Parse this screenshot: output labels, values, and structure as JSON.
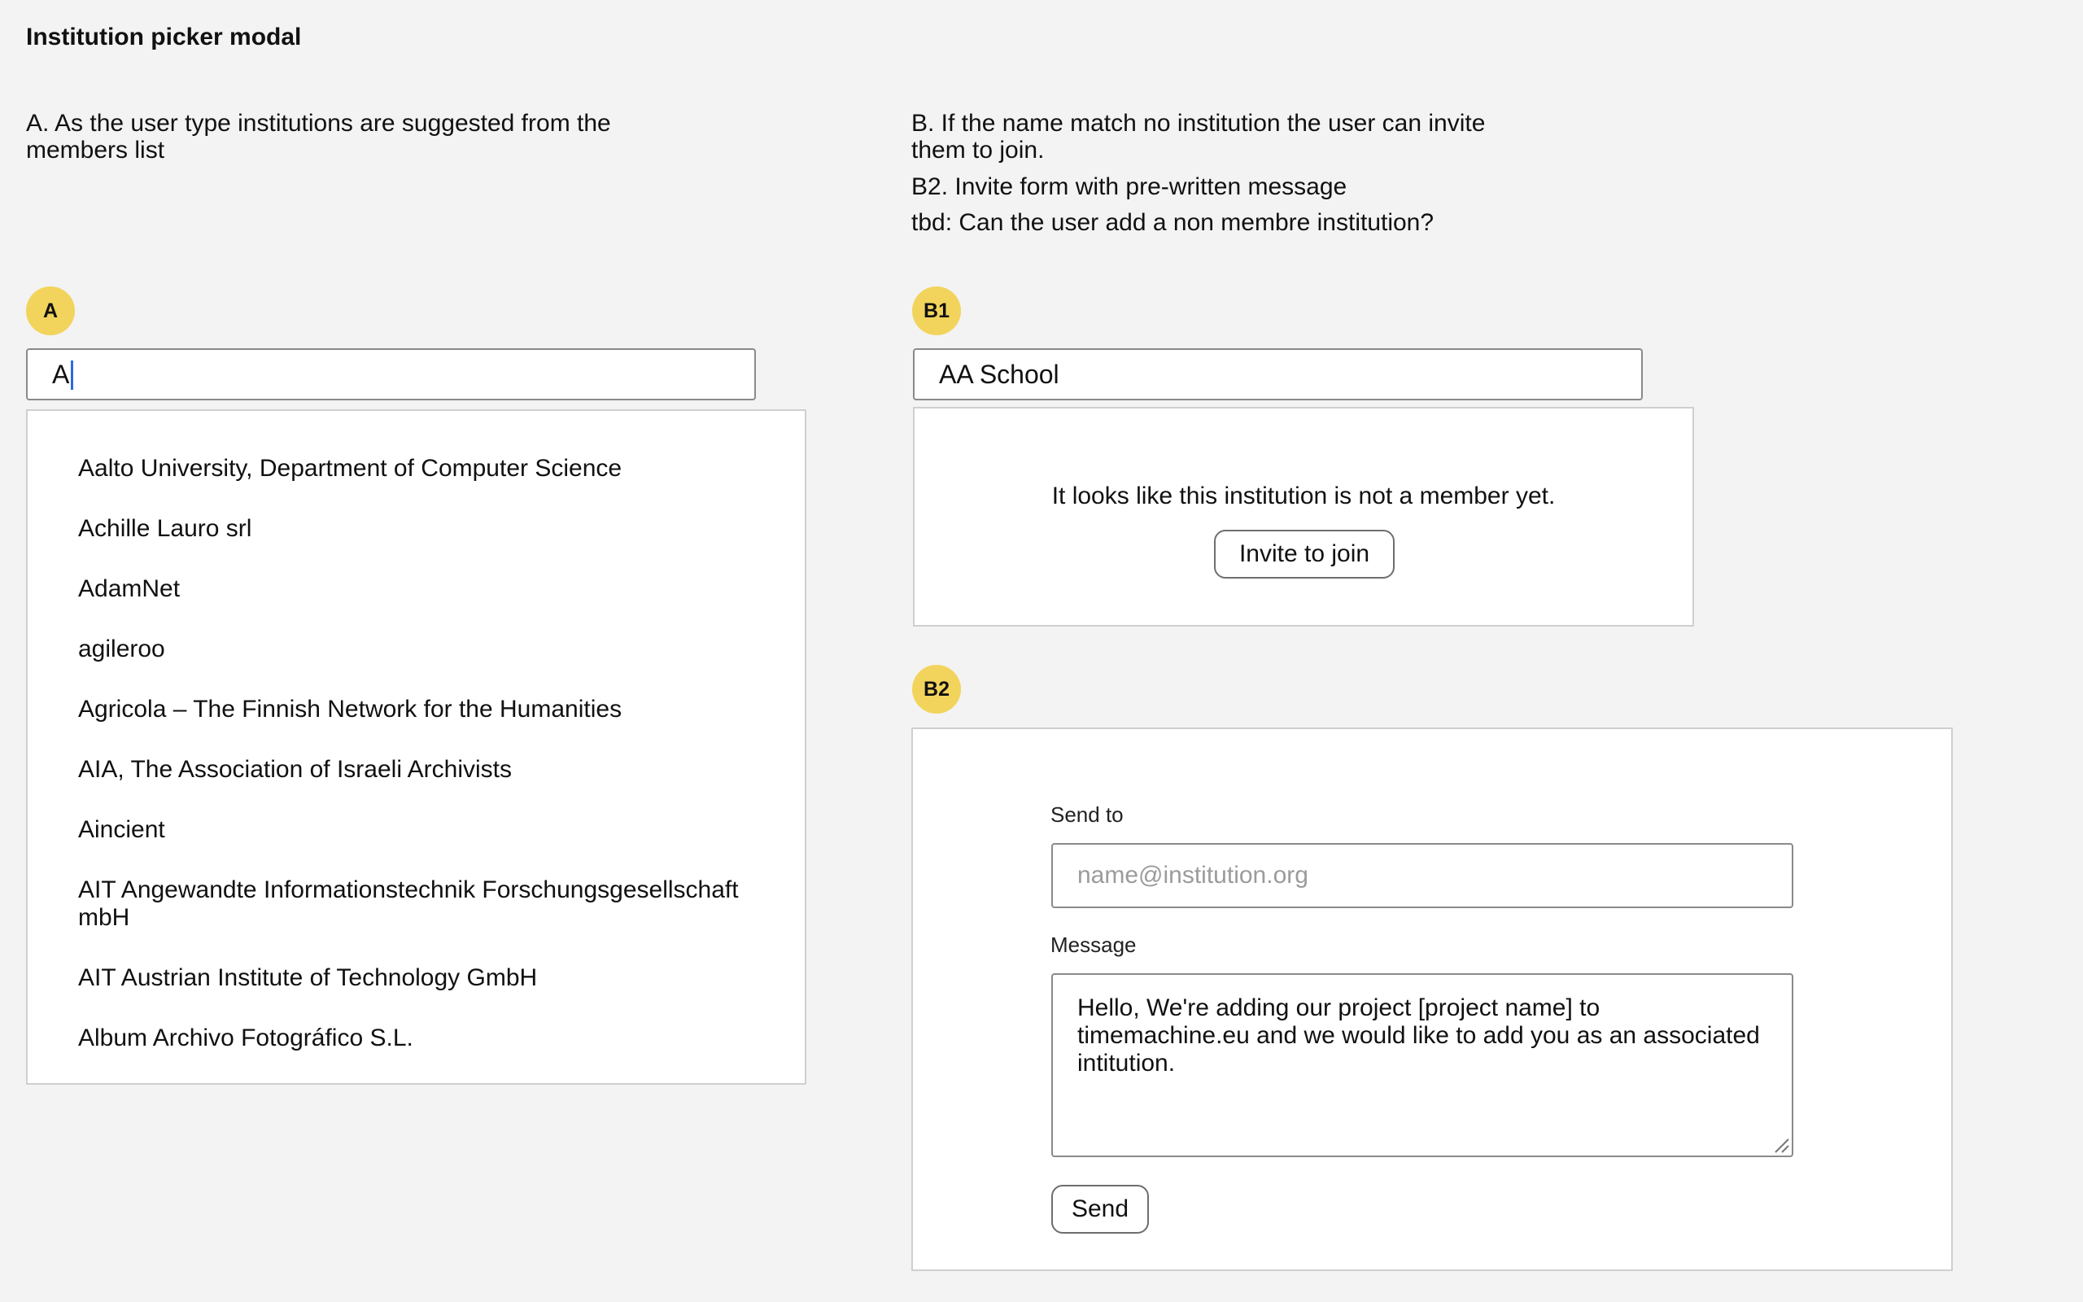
{
  "page_title": "Institution picker modal",
  "notes": {
    "a": "A. As the user type institutions are suggested from the members list",
    "b1": "B. If the name match no institution the user can invite them to join.",
    "b2": "B2. Invite form with pre-written message",
    "tbd": "tbd: Can the user add a non membre institution?"
  },
  "badges": {
    "a": "A",
    "b1": "B1",
    "b2": "B2"
  },
  "section_a": {
    "search_value": "A",
    "suggestions": [
      "Aalto University, Department of Computer Science",
      "Achille Lauro srl",
      "AdamNet",
      "agileroo",
      "Agricola – The Finnish Network for the Humanities",
      "AIA, The Association of Israeli Archivists",
      "Aincient",
      "AIT Angewandte Informationstechnik Forschungsgesellschaft mbH",
      "AIT Austrian Institute of Technology GmbH",
      "Album Archivo Fotográfico S.L."
    ]
  },
  "section_b1": {
    "search_value": "AA School",
    "not_member_text": "It looks like this institution is not a member yet.",
    "invite_button": "Invite to join"
  },
  "section_b2": {
    "send_to_label": "Send to",
    "email_placeholder": "name@institution.org",
    "message_label": "Message",
    "message_value": "Hello, We're adding our project [project name] to timemachine.eu and we would like to add you as an associated intitution.",
    "send_button": "Send"
  },
  "colors": {
    "background": "#f3f3f3",
    "badge": "#f2d45c",
    "caret": "#2b6be0"
  }
}
